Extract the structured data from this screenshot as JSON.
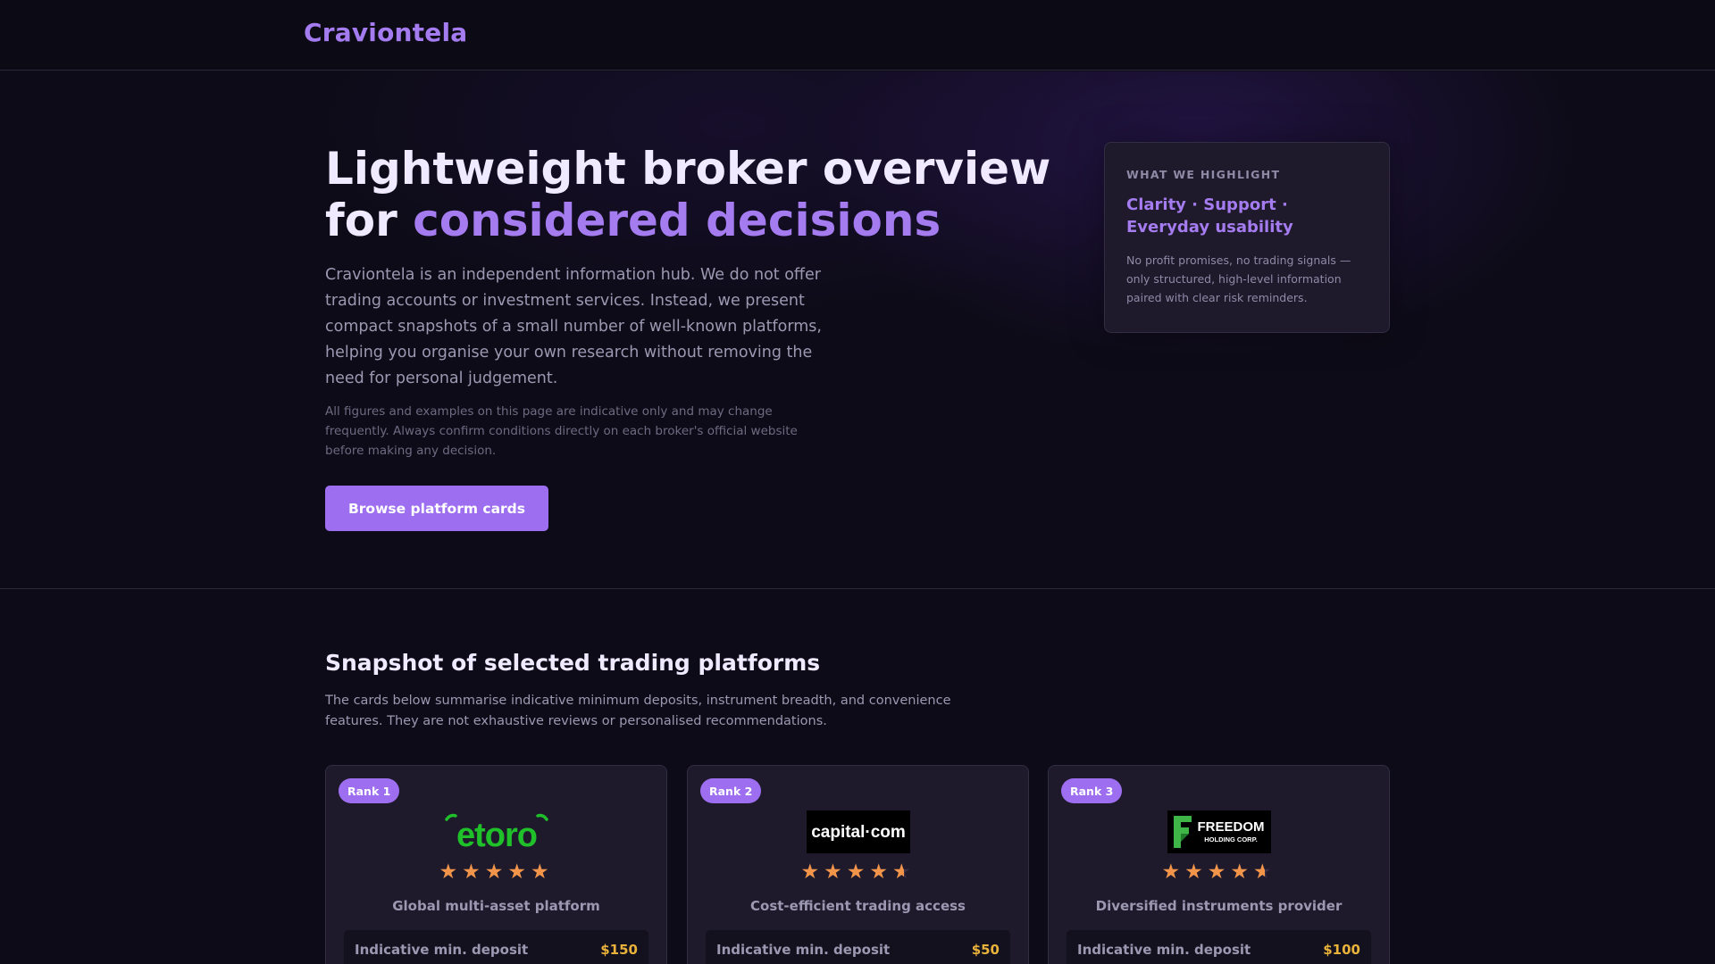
{
  "header": {
    "brand": "Craviontela"
  },
  "hero": {
    "title_line1": "Lightweight broker overview",
    "title_prefix": "for ",
    "title_accent": "considered decisions",
    "intro": "Craviontela is an independent information hub. We do not offer trading accounts or investment services. Instead, we present compact snapshots of a small number of well-known platforms, helping you organise your own research without removing the need for personal judgement.",
    "note": "All figures and examples on this page are indicative only and may change frequently. Always confirm conditions directly on each broker's official website before making any decision.",
    "cta_label": "Browse platform cards"
  },
  "highlight": {
    "kicker": "WHAT WE HIGHLIGHT",
    "title": "Clarity · Support · Everyday usability",
    "text": "No profit promises, no trading signals — only structured, high-level information paired with clear risk reminders."
  },
  "platforms_section": {
    "title": "Snapshot of selected trading platforms",
    "text": "The cards below summarise indicative minimum deposits, instrument breadth, and convenience features. They are not exhaustive reviews or personalised recommendations.",
    "deposit_label": "Indicative min. deposit"
  },
  "cards": [
    {
      "rank": "Rank 1",
      "logo_text": "etoro",
      "rating": 5,
      "tagline": "Global multi-asset platform",
      "deposit": "$150"
    },
    {
      "rank": "Rank 2",
      "logo_text": "capital·com",
      "rating": 4.5,
      "tagline": "Cost-efficient trading access",
      "deposit": "$50"
    },
    {
      "rank": "Rank 3",
      "logo_text": "FREEDOM",
      "logo_subtext": "HOLDING CORP.",
      "rating": 4.5,
      "tagline": "Diversified instruments provider",
      "deposit": "$100"
    }
  ],
  "colors": {
    "accent": "#9d6ff0",
    "star": "#f2954a",
    "deposit_value": "#e9b23a",
    "etoro_green": "#1fc02a",
    "freedom_green": "#3fb547"
  }
}
